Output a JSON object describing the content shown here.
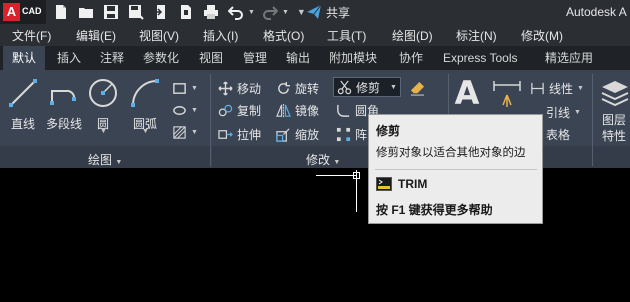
{
  "app": {
    "logo_letter": "A",
    "logo_text": "CAD",
    "title": "Autodesk A",
    "share_label": "共享"
  },
  "menu": [
    "文件(F)",
    "编辑(E)",
    "视图(V)",
    "插入(I)",
    "格式(O)",
    "工具(T)",
    "绘图(D)",
    "标注(N)",
    "修改(M)"
  ],
  "tabs": [
    "默认",
    "插入",
    "注释",
    "参数化",
    "视图",
    "管理",
    "输出",
    "附加模块",
    "协作",
    "Express Tools",
    "精选应用"
  ],
  "active_tab": "默认",
  "ribbon": {
    "draw": {
      "title": "绘图",
      "line": "直线",
      "polyline": "多段线",
      "circle": "圆",
      "arc": "圆弧"
    },
    "modify": {
      "title": "修改",
      "move": "移动",
      "rotate": "旋转",
      "trim": "修剪",
      "copy": "复制",
      "mirror": "镜像",
      "fillet": "圆角",
      "stretch": "拉伸",
      "scale": "缩放",
      "array": "阵"
    },
    "annotation": {
      "text_glyph": "A",
      "linear": "线性",
      "leader": "引线",
      "table": "表格"
    },
    "layers": {
      "label_line1": "图层",
      "label_line2": "特性"
    }
  },
  "tooltip": {
    "title": "修剪",
    "description": "修剪对象以适合其他对象的边",
    "command": "TRIM",
    "help": "按 F1 键获得更多帮助"
  },
  "colors": {
    "ribbon": "#3b4453",
    "titlebar": "#2b2e33",
    "tabbar": "#1f2226",
    "brand_red": "#d8232a",
    "share_blue": "#4aa3df"
  }
}
